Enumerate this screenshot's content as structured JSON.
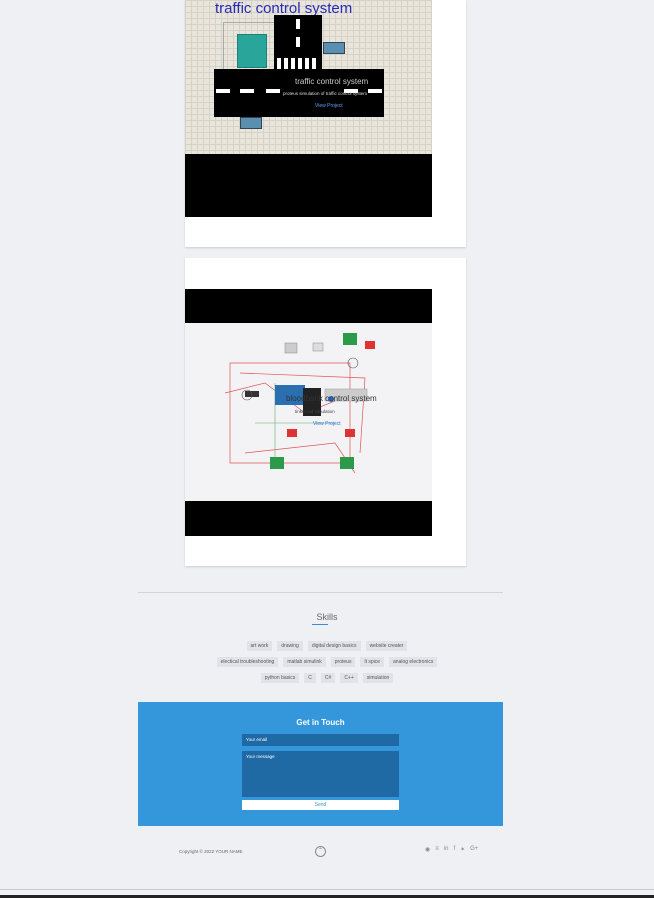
{
  "projects": [
    {
      "image_title": "traffic control system",
      "overlay_title": "traffic control system",
      "overlay_subtitle": "proteus simulation of traffic control system",
      "link_label": "View Project"
    },
    {
      "image_title": "",
      "overlay_title": "bloodbank control system",
      "overlay_subtitle": "tinkercad simulation",
      "link_label": "View Project"
    }
  ],
  "skills": {
    "title": "Skills",
    "rows": [
      [
        "art work",
        "drawing",
        "digital design basics",
        "website creater"
      ],
      [
        "electical troubleshooting",
        "matlab simulink",
        "proteus",
        "lt spice",
        "analog electronics"
      ],
      [
        "python basics",
        "C",
        "C#",
        "C++",
        "simulation"
      ]
    ]
  },
  "contact": {
    "title": "Get in Touch",
    "email_placeholder": "Your email",
    "message_placeholder": "Your message",
    "send_label": "Send"
  },
  "footer": {
    "copyright": "Copyright © 2022 YOUR NAME",
    "up_icon": "chevron-up-icon",
    "social_icons": [
      "github-icon",
      "stackoverflow-icon",
      "linkedin-icon",
      "facebook-icon",
      "twitter-icon",
      "googleplus-icon"
    ]
  },
  "colors": {
    "accent": "#3497db",
    "background": "#eff0f3"
  }
}
